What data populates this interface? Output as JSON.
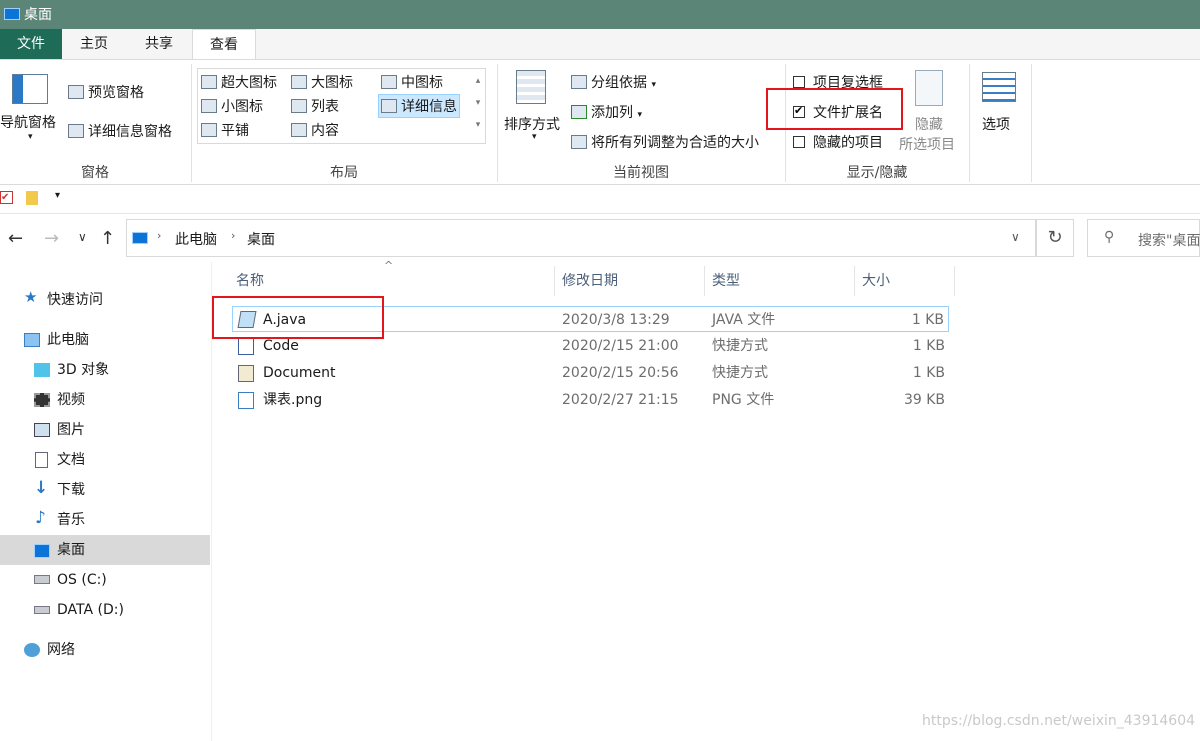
{
  "window": {
    "title": "桌面"
  },
  "tabs": [
    {
      "label": "文件"
    },
    {
      "label": "主页"
    },
    {
      "label": "共享"
    },
    {
      "label": "查看"
    }
  ],
  "ribbon": {
    "panes": {
      "group_label": "窗格",
      "nav_pane": "导航窗格",
      "preview_pane": "预览窗格",
      "details_pane": "详细信息窗格"
    },
    "layout": {
      "group_label": "布局",
      "items": [
        "超大图标",
        "大图标",
        "中图标",
        "小图标",
        "列表",
        "详细信息",
        "平铺",
        "内容"
      ],
      "selected": "详细信息"
    },
    "current_view": {
      "group_label": "当前视图",
      "sort_by": "排序方式",
      "group_by": "分组依据",
      "add_columns": "添加列",
      "size_all": "将所有列调整为合适的大小"
    },
    "show_hide": {
      "group_label": "显示/隐藏",
      "item_checkboxes": {
        "label": "项目复选框",
        "checked": false
      },
      "file_extensions": {
        "label": "文件扩展名",
        "checked": true
      },
      "hidden_items": {
        "label": "隐藏的项目",
        "checked": false
      },
      "hide_selected_1": "隐藏",
      "hide_selected_2": "所选项目"
    },
    "options": {
      "label": "选项"
    }
  },
  "address": {
    "crumbs": [
      "此电脑",
      "桌面"
    ],
    "search_placeholder": "搜索\"桌面"
  },
  "nav": {
    "quick_access": "快速访问",
    "this_pc": "此电脑",
    "items": [
      "3D 对象",
      "视频",
      "图片",
      "文档",
      "下载",
      "音乐",
      "桌面",
      "OS (C:)",
      "DATA (D:)"
    ],
    "network": "网络"
  },
  "columns": [
    "名称",
    "修改日期",
    "类型",
    "大小"
  ],
  "files": [
    {
      "name": "A.java",
      "date": "2020/3/8 13:29",
      "type": "JAVA 文件",
      "size": "1 KB"
    },
    {
      "name": "Code",
      "date": "2020/2/15 21:00",
      "type": "快捷方式",
      "size": "1 KB"
    },
    {
      "name": "Document",
      "date": "2020/2/15 20:56",
      "type": "快捷方式",
      "size": "1 KB"
    },
    {
      "name": "课表.png",
      "date": "2020/2/27 21:15",
      "type": "PNG 文件",
      "size": "39 KB"
    }
  ],
  "watermark": "https://blog.csdn.net/weixin_43914604",
  "colors": {
    "title_bar": "#5a8577",
    "file_tab": "#1e6b57",
    "highlight": "#e3161b",
    "selection": "#cce8ff"
  }
}
